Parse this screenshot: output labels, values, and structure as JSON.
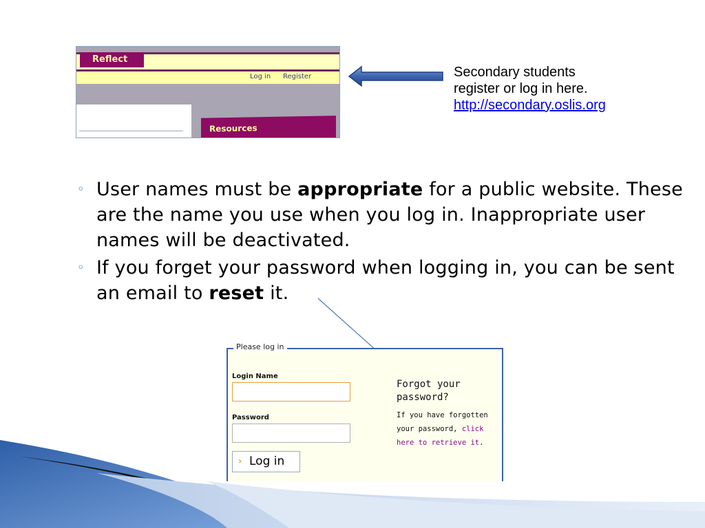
{
  "top_screenshot": {
    "reflect_tab": "Reflect",
    "login_link": "Log in",
    "register_link": "Register",
    "resources_tab": "Resources"
  },
  "note": {
    "line1": "Secondary students",
    "line2": "register or log in here.",
    "url": "http://secondary.oslis.org"
  },
  "bullets": {
    "b1_pre": "User names must be ",
    "b1_bold": "appropriate",
    "b1_post": " for a public website.  These are the name you use when you log in. Inappropriate user names will be deactivated.",
    "b2_pre": "If you forget your password when logging in, you can be sent an email to ",
    "b2_bold": "reset",
    "b2_post": " it."
  },
  "login_form": {
    "legend": "Please log in",
    "login_name_label": "Login Name",
    "login_name_value": "",
    "password_label": "Password",
    "password_value": "",
    "login_button": "Log in",
    "forgot_title": "Forgot your password?",
    "forgot_text_pre": "If you have forgotten your password, ",
    "forgot_link": "click here to retrieve it",
    "forgot_text_post": "."
  },
  "colors": {
    "magenta": "#8e0b62",
    "pale_yellow": "#ffffc0",
    "link_blue": "#0000ee",
    "accent_blue": "#3a62a8"
  }
}
